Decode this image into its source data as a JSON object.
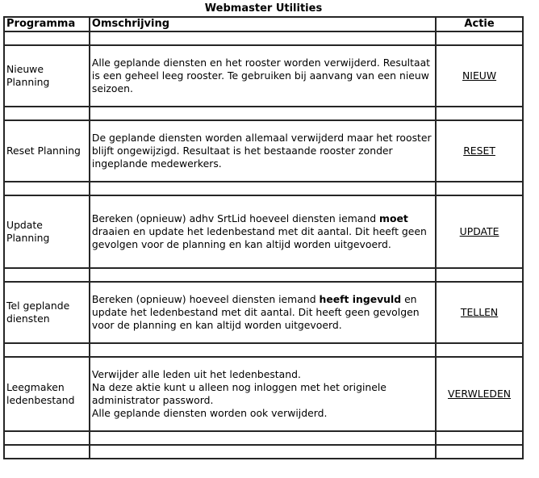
{
  "page": {
    "title": "Webmaster Utilities"
  },
  "table": {
    "headers": {
      "programma": "Programma",
      "omschrijving": "Omschrijving",
      "actie": "Actie"
    },
    "rows": [
      {
        "programma": "Nieuwe Planning",
        "description": [
          {
            "text": "Alle geplande diensten en het rooster worden verwijderd. Resultaat is een geheel leeg rooster. Te gebruiken bij aanvang van een nieuw seizoen.",
            "bold": false
          }
        ],
        "action": "NIEUW"
      },
      {
        "programma": "Reset Planning",
        "description": [
          {
            "text": "De geplande diensten worden allemaal verwijderd maar het rooster blijft ongewijzigd. Resultaat is het bestaande rooster zonder ingeplande medewerkers.",
            "bold": false
          }
        ],
        "action": "RESET"
      },
      {
        "programma": "Update Planning",
        "description": [
          {
            "text": "Bereken (opnieuw) adhv SrtLid hoeveel diensten iemand ",
            "bold": false
          },
          {
            "text": "moet",
            "bold": true
          },
          {
            "text": " draaien en update het ledenbestand met dit aantal. Dit heeft geen gevolgen voor de planning en kan altijd worden uitgevoerd.",
            "bold": false
          }
        ],
        "action": "UPDATE"
      },
      {
        "programma": "Tel geplande diensten",
        "description": [
          {
            "text": "Bereken (opnieuw) hoeveel diensten iemand ",
            "bold": false
          },
          {
            "text": "heeft ingevuld",
            "bold": true
          },
          {
            "text": " en update het ledenbestand met dit aantal. Dit heeft geen gevolgen voor de planning en kan altijd worden uitgevoerd.",
            "bold": false
          }
        ],
        "action": "TELLEN"
      },
      {
        "programma": "Leegmaken ledenbestand",
        "description_lines": [
          "Verwijder alle leden uit het ledenbestand.",
          "Na deze aktie kunt u alleen nog inloggen met het originele administrator password.",
          "Alle geplande diensten worden ook verwijderd."
        ],
        "action": "VERWLEDEN"
      }
    ]
  }
}
